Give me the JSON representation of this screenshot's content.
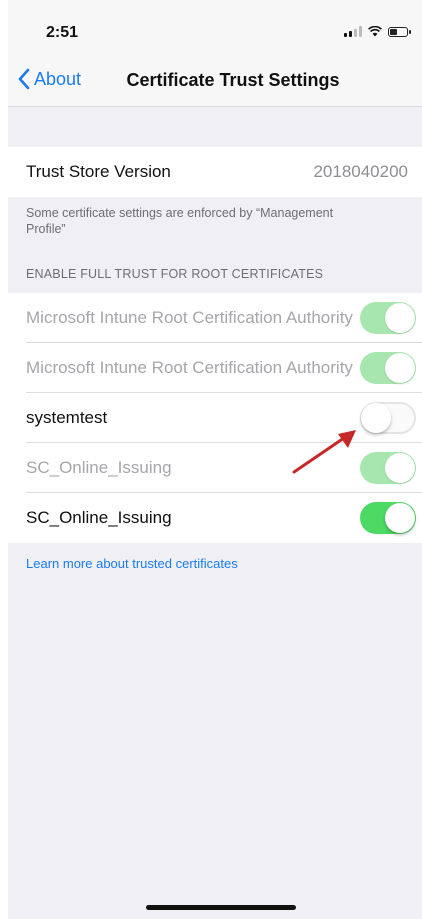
{
  "status_bar": {
    "time": "2:51"
  },
  "nav": {
    "back_label": "About",
    "title": "Certificate Trust Settings"
  },
  "trust_store": {
    "label": "Trust Store Version",
    "value": "2018040200"
  },
  "enforced_note": "Some certificate settings are enforced by “Management Profile”",
  "section_header": "ENABLE FULL TRUST FOR ROOT CERTIFICATES",
  "certificates": [
    {
      "label": "Microsoft Intune Root Certification Authority",
      "enabled": true,
      "managed": true
    },
    {
      "label": "Microsoft Intune Root Certification Authority",
      "enabled": true,
      "managed": true
    },
    {
      "label": "systemtest",
      "enabled": false,
      "managed": false
    },
    {
      "label": "SC_Online_Issuing",
      "enabled": true,
      "managed": true
    },
    {
      "label": "SC_Online_Issuing",
      "enabled": true,
      "managed": false
    }
  ],
  "learn_more_link": "Learn more about trusted certificates",
  "colors": {
    "accent": "#1a7cf5",
    "toggle_on": "#4cd964",
    "annotation_arrow": "#c62828"
  }
}
